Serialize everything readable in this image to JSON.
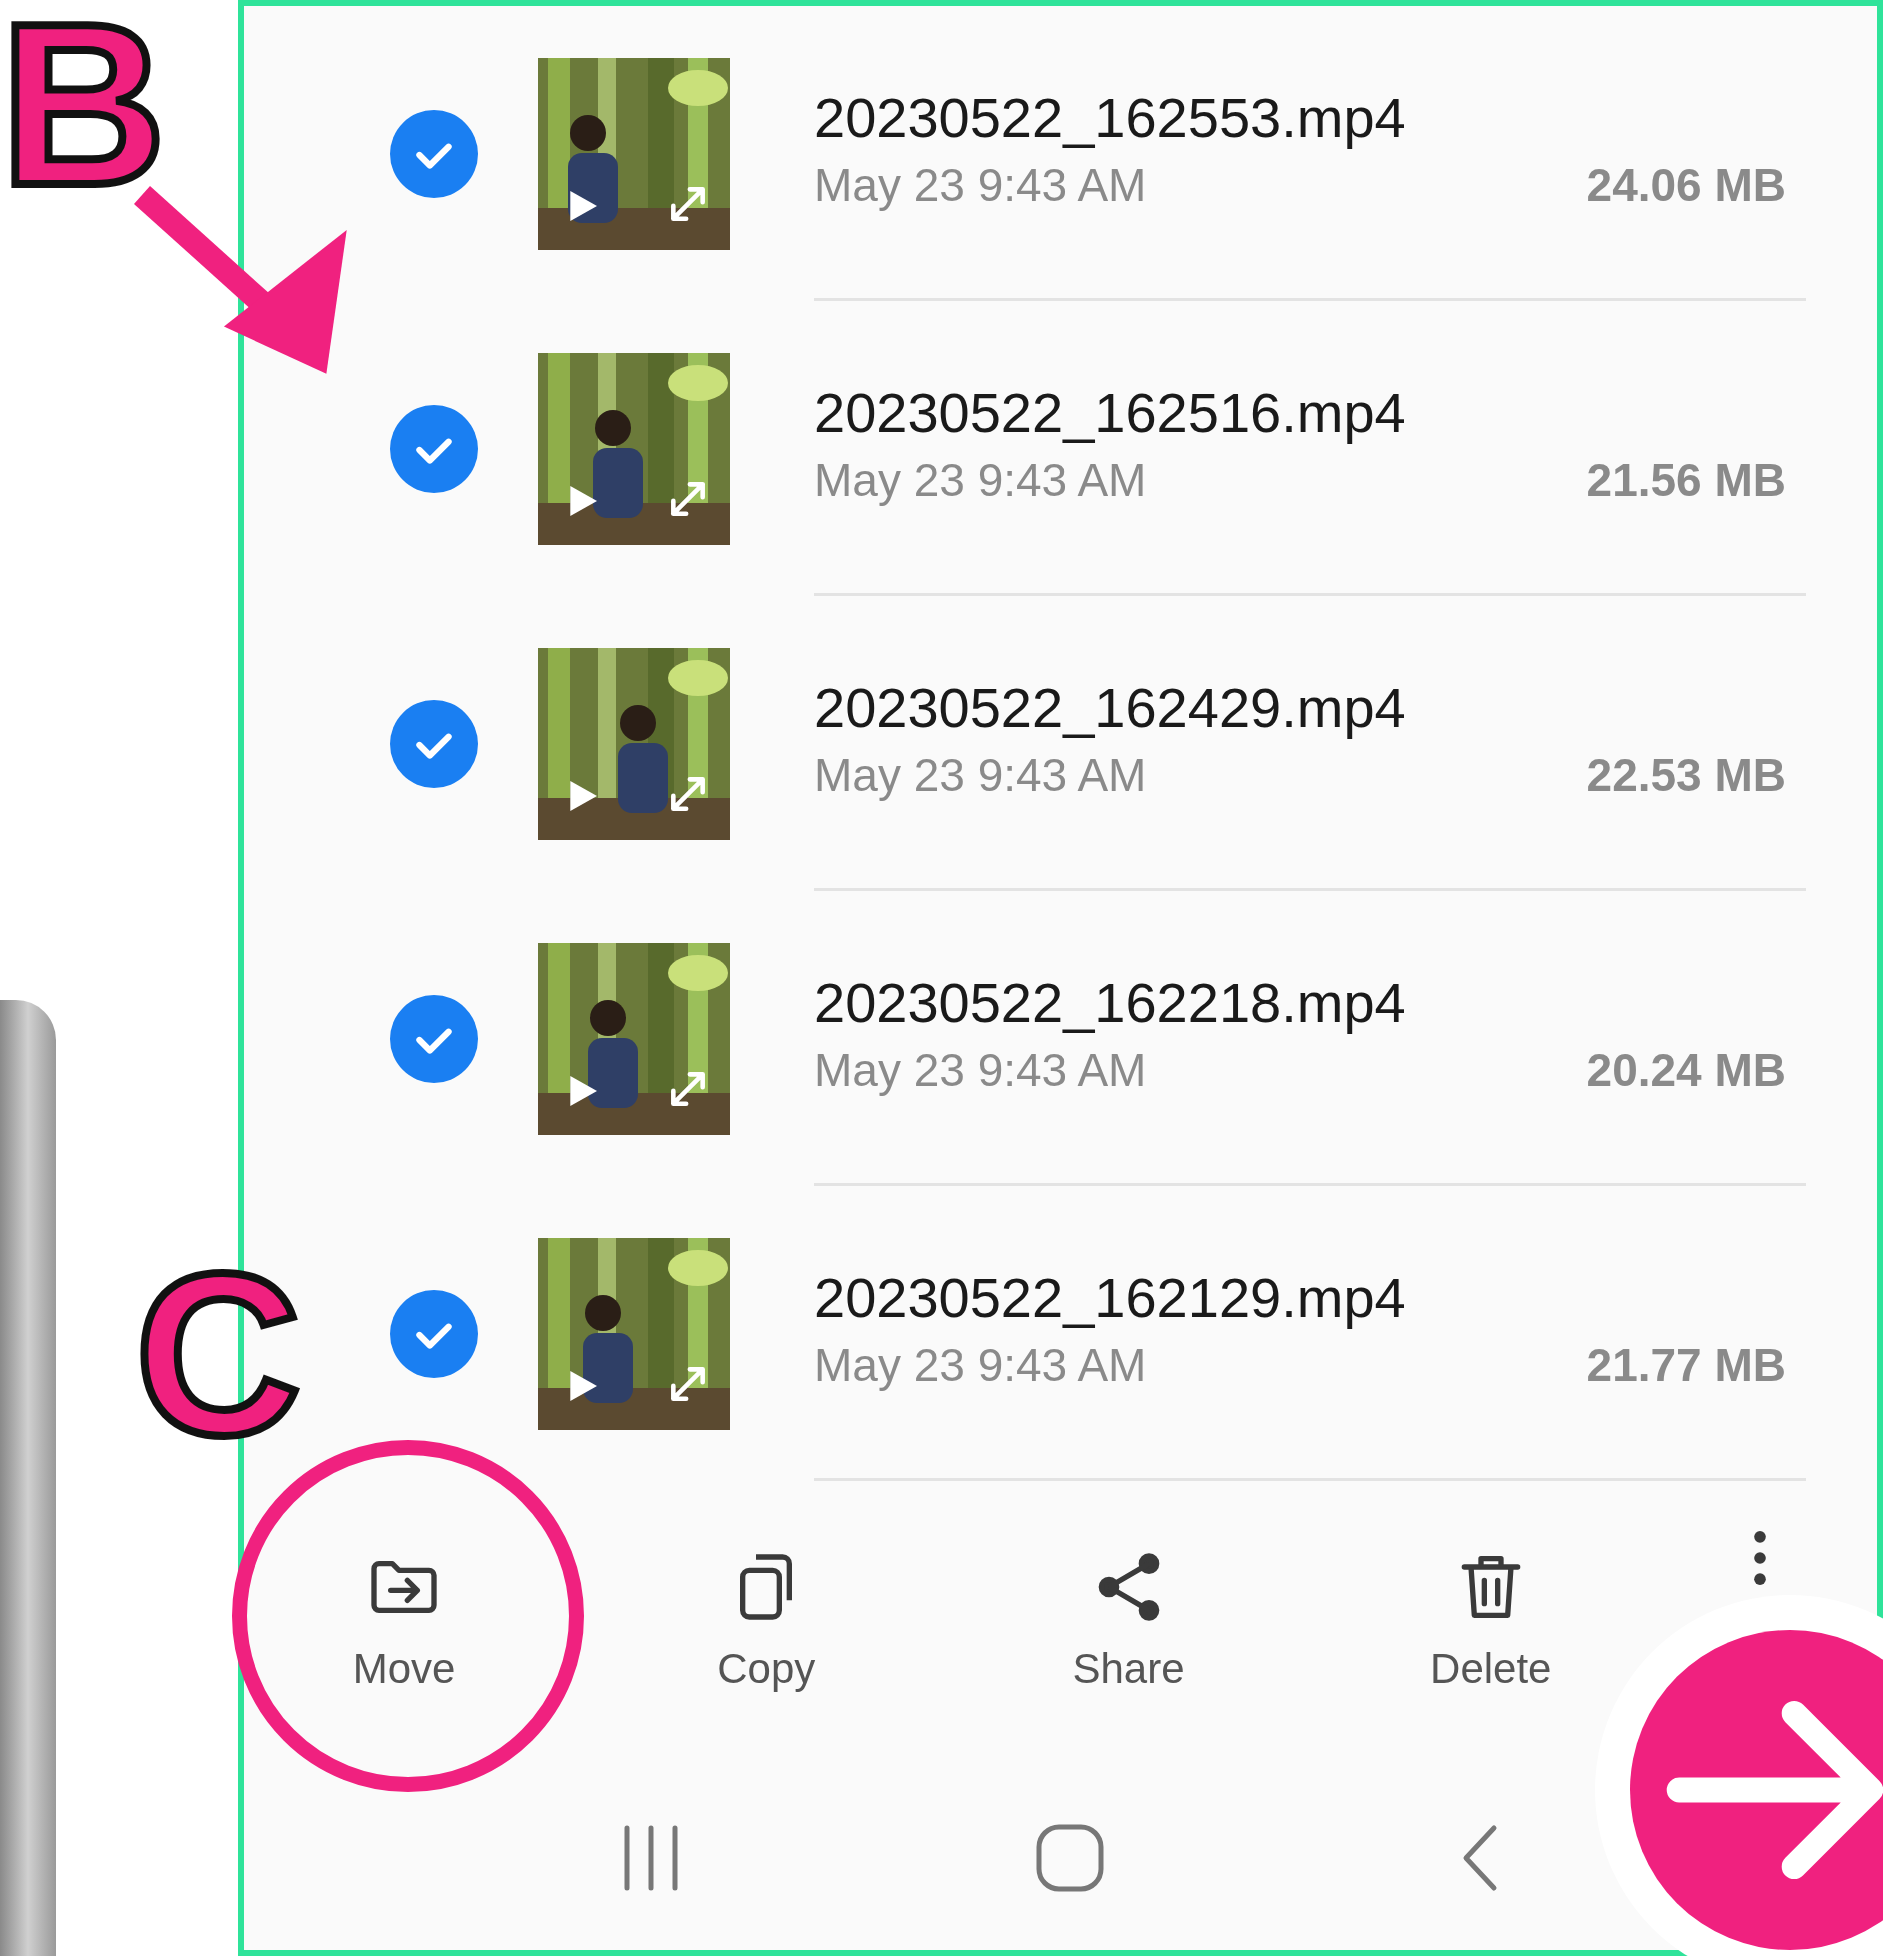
{
  "annotation_labels": [
    "B",
    "C"
  ],
  "files": [
    {
      "name": "20230522_162553.mp4",
      "date": "May 23 9:43 AM",
      "size": "24.06 MB",
      "checked": true
    },
    {
      "name": "20230522_162516.mp4",
      "date": "May 23 9:43 AM",
      "size": "21.56 MB",
      "checked": true
    },
    {
      "name": "20230522_162429.mp4",
      "date": "May 23 9:43 AM",
      "size": "22.53 MB",
      "checked": true
    },
    {
      "name": "20230522_162218.mp4",
      "date": "May 23 9:43 AM",
      "size": "20.24 MB",
      "checked": true
    },
    {
      "name": "20230522_162129.mp4",
      "date": "May 23 9:43 AM",
      "size": "21.77 MB",
      "checked": true
    }
  ],
  "actions": [
    {
      "kind": "move",
      "label": "Move"
    },
    {
      "kind": "copy",
      "label": "Copy"
    },
    {
      "kind": "share",
      "label": "Share"
    },
    {
      "kind": "delete",
      "label": "Delete"
    },
    {
      "kind": "more"
    }
  ]
}
